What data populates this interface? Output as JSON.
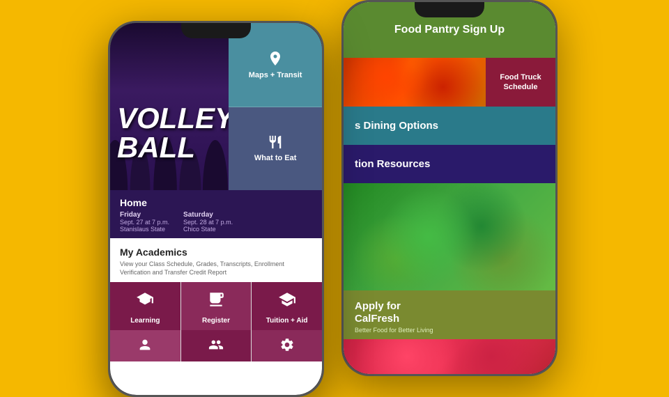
{
  "page": {
    "background_color": "#F5B800"
  },
  "phone_left": {
    "hero": {
      "volleyball_text": "VOLLEY\nBALL",
      "maps_transit": {
        "label": "Maps + Transit"
      },
      "what_to_eat": {
        "label": "What to Eat"
      }
    },
    "home_section": {
      "title": "Home",
      "games": [
        {
          "day": "Friday",
          "date": "Sept. 27 at 7 p.m.",
          "opponent": "Stanislaus State"
        },
        {
          "day": "Saturday",
          "date": "Sept. 28 at 7 p.m.",
          "opponent": "Chico State"
        }
      ]
    },
    "academics": {
      "title": "My Academics",
      "description": "View your Class Schedule, Grades, Transcripts, Enrollment Verification and Transfer Credit Report"
    },
    "grid": {
      "items": [
        {
          "label": "Learning",
          "icon": "📖"
        },
        {
          "label": "Register",
          "icon": "🖥"
        },
        {
          "label": "Tuition + Aid",
          "icon": "🎓"
        }
      ]
    }
  },
  "phone_right": {
    "food_pantry": {
      "title": "Food Pantry\nSign Up"
    },
    "food_truck": {
      "label": "Food Truck\nSchedule"
    },
    "dining_options": {
      "label": "Dining Options"
    },
    "nutrition_resources": {
      "label": "ition Resources"
    },
    "calfresh": {
      "title": "Apply for\nCalFresh",
      "subtitle": "Better Food for Better Living"
    }
  }
}
